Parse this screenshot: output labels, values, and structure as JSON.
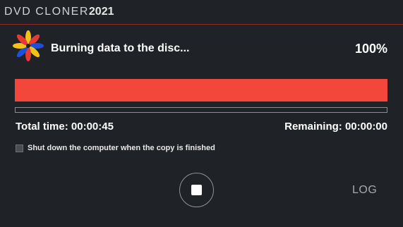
{
  "app": {
    "title_main": "DVD CLONER",
    "title_year": "2021"
  },
  "status": {
    "message": "Burning data to the disc...",
    "percent_text": "100%",
    "progress": 1.0,
    "sub_progress": 0.0
  },
  "times": {
    "total": "Total time: 00:00:45",
    "remaining": "Remaining: 00:00:00"
  },
  "options": {
    "shutdown_label": "Shut down the computer when the copy is finished",
    "shutdown_checked": false
  },
  "controls": {
    "stop_icon": "stop-icon",
    "log_label": "LOG"
  },
  "colors": {
    "background": "#1f2226",
    "accent_red": "#f3473b",
    "divider_red": "#9a2727"
  }
}
